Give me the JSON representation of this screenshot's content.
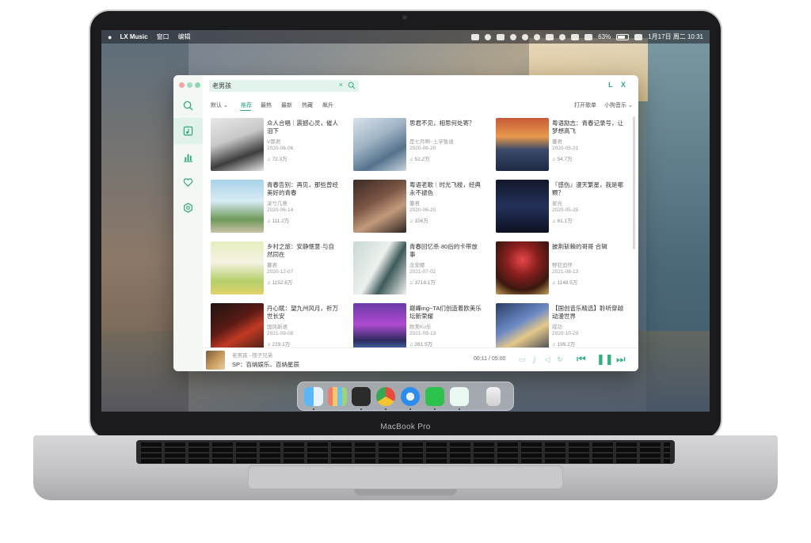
{
  "device_label": "MacBook Pro",
  "menubar": {
    "app_name": "LX Music",
    "menus": [
      "窗口",
      "编辑"
    ],
    "battery": "63%",
    "datetime": "1月17日 周二  10:31"
  },
  "app": {
    "logo": "L X",
    "search": {
      "value": "老男孩",
      "clear_icon": "×"
    },
    "sidebar": [
      "search-icon",
      "song-list-icon",
      "leaderboard-icon",
      "favorite-icon",
      "settings-icon"
    ],
    "filters": {
      "sort_label": "默认",
      "tabs": [
        "推荐",
        "最热",
        "最新",
        "热藏",
        "飙升"
      ],
      "active_tab": "推荐",
      "open_list": "打开歌单",
      "source": "小狗音乐"
    },
    "cards": [
      {
        "title": "众人合唱｜震撼心灵，催人泪下",
        "author": "V那君",
        "date": "2020-06-06",
        "plays": "72.3万"
      },
      {
        "title": "思君不见，相思何处寄？",
        "author": "是七月啊~上学暂退",
        "date": "2020-06-20",
        "plays": "52.2万"
      },
      {
        "title": "粤语励志：青春记录号，让梦想高飞",
        "author": "蔓君",
        "date": "2020-05-31",
        "plays": "54.7万"
      },
      {
        "title": "青春告别：再见，那些曾经美好的青春",
        "author": "凌兮几意",
        "date": "2020-06-14",
        "plays": "111.2万"
      },
      {
        "title": "粤语老歌｜时光飞梭，经典永不褪色",
        "author": "蔓君",
        "date": "2020-06-20",
        "plays": "156万"
      },
      {
        "title": "『感伤』漫天繁星，我是哪颗？",
        "author": "星光",
        "date": "2020-05-25",
        "plays": "61.1万"
      },
      {
        "title": "乡村之旅：安静惬意·与自然同在",
        "author": "蔓君",
        "date": "2020-12-07",
        "plays": "1152.6万"
      },
      {
        "title": "青春回忆杀·80后的卡带放事",
        "author": "念安娜",
        "date": "2021-07-02",
        "plays": "3718.1万"
      },
      {
        "title": "披荆斩棘的哥哥 合辑",
        "author": "野狂追怀",
        "date": "2021-08-13",
        "plays": "1148.5万"
      },
      {
        "title": "丹心赋：望九州风月，祈万世长安",
        "author": "国风新语",
        "date": "2021-09-08",
        "plays": "229.1万"
      },
      {
        "title": "巅峰ing~TA们创造着欧美乐坛新荣耀",
        "author": "欧美Ku乐",
        "date": "2021-09-13",
        "plays": "261.5万"
      },
      {
        "title": "【国创音乐精选】聆听穿越动漫世界",
        "author": "成功",
        "date": "2020-10-29",
        "plays": "199.2万"
      }
    ],
    "player": {
      "track": "老男孩 - 筷子兄弟",
      "subtitle": "SP：百纳娱乐、百纳星辰",
      "time": "00:11  /  05:00"
    }
  },
  "colors": {
    "accent": "#33a67a",
    "sidebar_bg": "#f3f8f5",
    "search_bg": "#e3f4ec"
  },
  "dock_icons": [
    "finder-icon",
    "launchpad-icon",
    "terminal-icon",
    "chrome-icon",
    "safari-icon",
    "wechat-icon",
    "lx-music-icon",
    "trash-icon"
  ]
}
